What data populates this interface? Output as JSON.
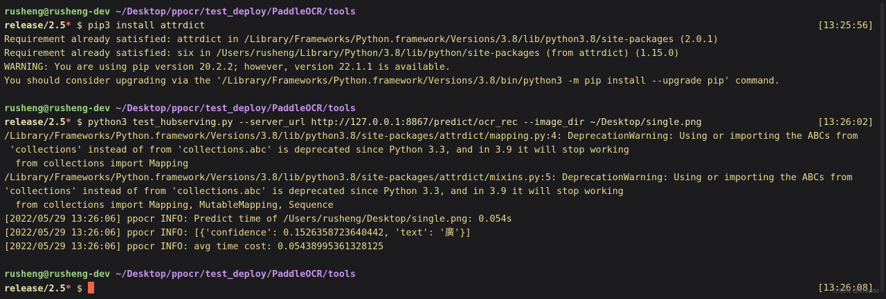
{
  "prompt": {
    "user_host": "rusheng@rusheng-dev",
    "path": "~/Desktop/ppocr/test_deploy/PaddleOCR/tools",
    "branch": "release/2.5",
    "dirty_marker": "*",
    "symbol": "$"
  },
  "block1": {
    "command": "pip3 install attrdict",
    "timestamp": "[13:25:56]",
    "output": [
      "Requirement already satisfied: attrdict in /Library/Frameworks/Python.framework/Versions/3.8/lib/python3.8/site-packages (2.0.1)",
      "Requirement already satisfied: six in /Users/rusheng/Library/Python/3.8/lib/python/site-packages (from attrdict) (1.15.0)",
      "WARNING: You are using pip version 20.2.2; however, version 22.1.1 is available.",
      "You should consider upgrading via the '/Library/Frameworks/Python.framework/Versions/3.8/bin/python3 -m pip install --upgrade pip' command."
    ]
  },
  "block2": {
    "command": "python3 test_hubserving.py --server_url http://127.0.0.1:8867/predict/ocr_rec --image_dir ~/Desktop/single.png",
    "timestamp": "[13:26:02]",
    "output": [
      "/Library/Frameworks/Python.framework/Versions/3.8/lib/python3.8/site-packages/attrdict/mapping.py:4: DeprecationWarning: Using or importing the ABCs from",
      " 'collections' instead of from 'collections.abc' is deprecated since Python 3.3, and in 3.9 it will stop working",
      "  from collections import Mapping",
      "/Library/Frameworks/Python.framework/Versions/3.8/lib/python3.8/site-packages/attrdict/mixins.py:5: DeprecationWarning: Using or importing the ABCs from",
      "'collections' instead of from 'collections.abc' is deprecated since Python 3.3, and in 3.9 it will stop working",
      "  from collections import Mapping, MutableMapping, Sequence",
      "[2022/05/29 13:26:06] ppocr INFO: Predict time of /Users/rusheng/Desktop/single.png: 0.054s",
      "[2022/05/29 13:26:06] ppocr INFO: [{'confidence': 0.1526358723640442, 'text': '廣'}]",
      "[2022/05/29 13:26:06] ppocr INFO: avg time cost: 0.05438995361328125"
    ]
  },
  "block3": {
    "command": "",
    "timestamp": "[13:26:08]"
  },
  "colors": {
    "background": "#1c1c1f",
    "user_host": "#9ad07f",
    "path": "#c792ea",
    "output": "#e6d690",
    "cursor": "#f06448"
  },
  "watermark": "CSDN @Vivaldo"
}
